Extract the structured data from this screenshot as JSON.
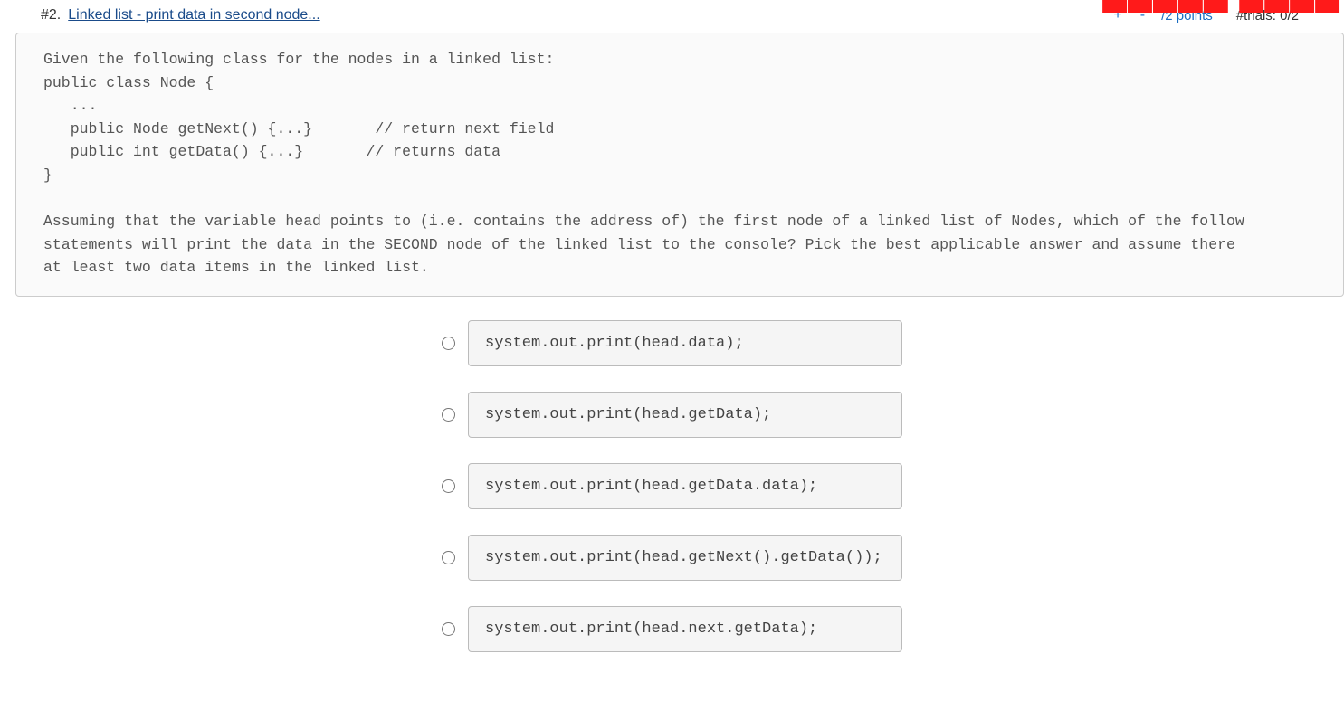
{
  "header": {
    "number": "#2.",
    "title": "Linked list - print data in second node...",
    "plus": "+",
    "minus": "-",
    "points": "/2 points",
    "trials": "#trials: 0/2"
  },
  "prompt": "Given the following class for the nodes in a linked list:\npublic class Node {\n   ...\n   public Node getNext() {...}       // return next field\n   public int getData() {...}       // returns data\n}\n\nAssuming that the variable head points to (i.e. contains the address of) the first node of a linked list of Nodes, which of the follow\nstatements will print the data in the SECOND node of the linked list to the console? Pick the best applicable answer and assume there\nat least two data items in the linked list.",
  "choices": [
    "system.out.print(head.data);",
    "system.out.print(head.getData);",
    "system.out.print(head.getData.data);",
    "system.out.print(head.getNext().getData());",
    "system.out.print(head.next.getData);"
  ]
}
